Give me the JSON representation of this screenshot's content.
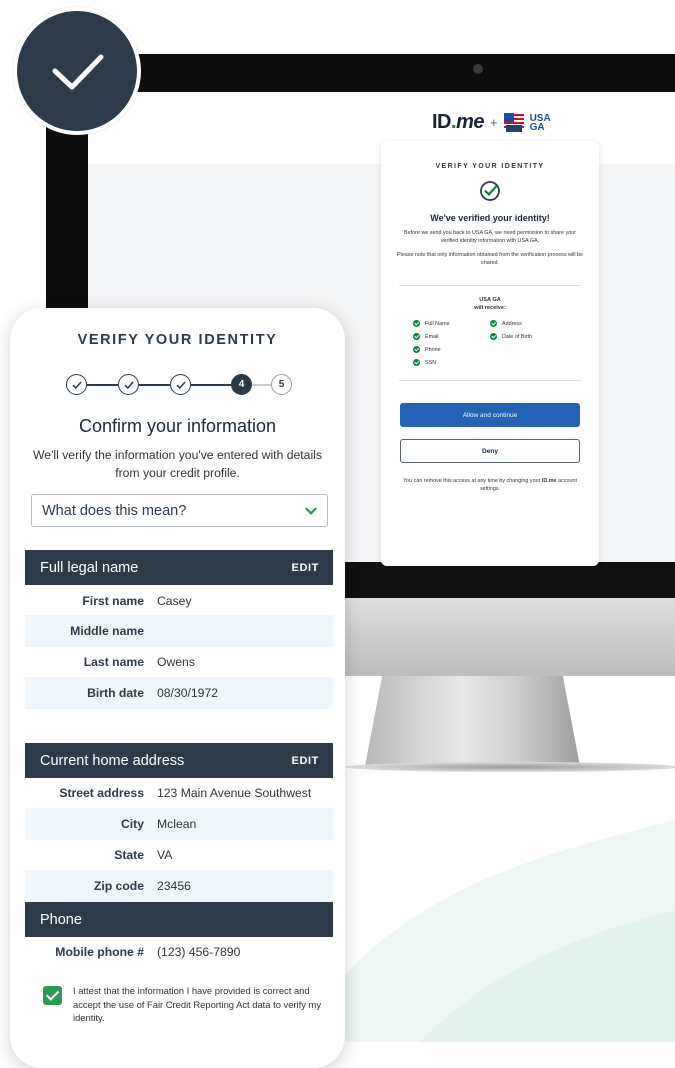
{
  "colors": {
    "navy": "#2d3a4a",
    "brand_green": "#08833d",
    "primary_blue": "#2462b6",
    "row_tint": "#f0f7fb"
  },
  "desktop_screen": {
    "logos": {
      "idme": {
        "id": "ID",
        "dot": ".",
        "me": "me"
      },
      "plus": "+",
      "partner_text_top": "USA",
      "partner_text_bottom": "GA"
    },
    "title": "VERIFY YOUR IDENTITY",
    "heading": "We've verified your identity!",
    "permission_text": "Before we send you back to USA GA, we need permission to share your verified identity information with USA GA.",
    "note_text": "Please note that only information obtained from the verification process will be shared.",
    "recipient": "USA GA",
    "recipient_sub": "will receive:",
    "shared_items": [
      "Full Name",
      "Address",
      "Email",
      "Date of Birth",
      "Phone",
      "SSN"
    ],
    "allow_button": "Allow and continue",
    "deny_button": "Deny",
    "footer_pre": "You can remove this access at any time by changing your ",
    "footer_bold": "ID.me",
    "footer_post": " account settings."
  },
  "mobile": {
    "title": "VERIFY YOUR IDENTITY",
    "steps": {
      "current": "4",
      "next": "5"
    },
    "heading": "Confirm your information",
    "subtext": "We'll verify the information you've entered with details from your credit profile.",
    "help_dropdown": "What does this mean?",
    "sections": {
      "name": {
        "title": "Full legal name",
        "edit": "EDIT",
        "rows": [
          {
            "label": "First name",
            "value": "Casey"
          },
          {
            "label": "Middle name",
            "value": ""
          },
          {
            "label": "Last name",
            "value": "Owens"
          },
          {
            "label": "Birth date",
            "value": "08/30/1972"
          }
        ]
      },
      "address": {
        "title": "Current home address",
        "edit": "EDIT",
        "rows": [
          {
            "label": "Street address",
            "value": "123 Main Avenue Southwest"
          },
          {
            "label": "City",
            "value": "Mclean"
          },
          {
            "label": "State",
            "value": "VA"
          },
          {
            "label": "Zip code",
            "value": "23456"
          }
        ]
      },
      "phone": {
        "title": "Phone",
        "rows": [
          {
            "label": "Mobile phone #",
            "value": "(123) 456-7890"
          }
        ]
      }
    },
    "attest_text": "I attest that the information I have provided is correct and accept the use of Fair Credit Reporting Act data to verify my identity."
  }
}
